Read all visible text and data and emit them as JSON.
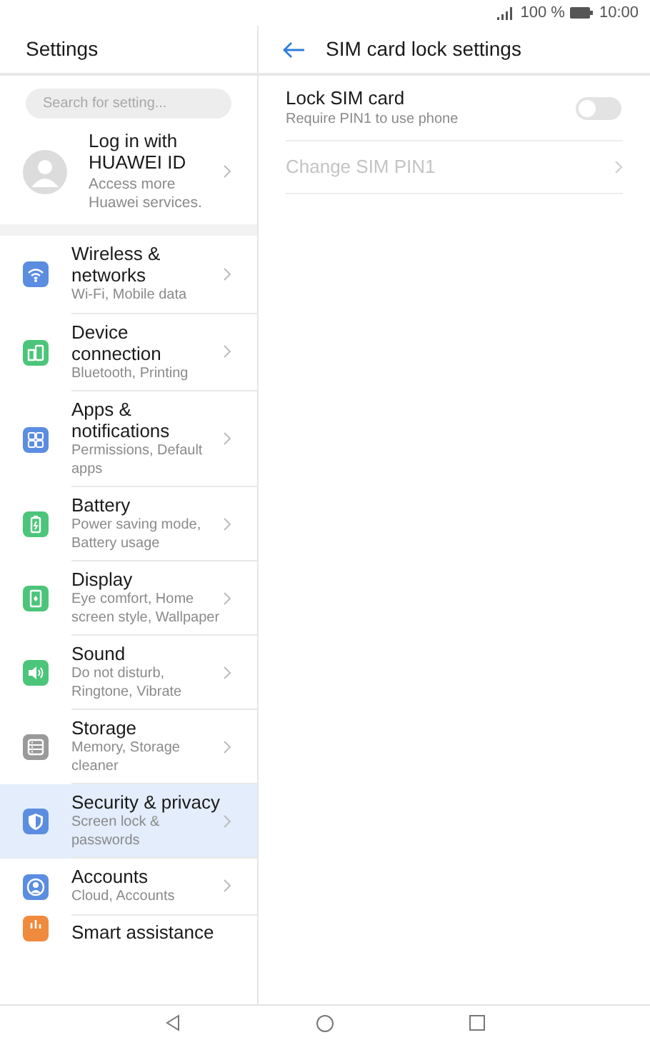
{
  "status_bar": {
    "battery_text": "100 %",
    "time": "10:00"
  },
  "sidebar": {
    "title": "Settings",
    "search": {
      "placeholder": "Search for setting..."
    },
    "account": {
      "title": "Log in with HUAWEI ID",
      "subtitle": "Access more Huawei services."
    },
    "items": [
      {
        "kind": "wifi",
        "color": "#5b8de0",
        "title": "Wireless & networks",
        "subtitle": "Wi-Fi, Mobile data",
        "selected": false
      },
      {
        "kind": "device",
        "color": "#4cc57a",
        "title": "Device connection",
        "subtitle": "Bluetooth, Printing",
        "selected": false
      },
      {
        "kind": "apps",
        "color": "#5b8de0",
        "title": "Apps & notifications",
        "subtitle": "Permissions, Default apps",
        "selected": false
      },
      {
        "kind": "battery",
        "color": "#4cc57a",
        "title": "Battery",
        "subtitle": "Power saving mode, Battery usage",
        "selected": false
      },
      {
        "kind": "display",
        "color": "#4cc57a",
        "title": "Display",
        "subtitle": "Eye comfort, Home screen style, Wallpaper",
        "selected": false
      },
      {
        "kind": "sound",
        "color": "#4cc57a",
        "title": "Sound",
        "subtitle": "Do not disturb, Ringtone, Vibrate",
        "selected": false
      },
      {
        "kind": "storage",
        "color": "#9a9a9a",
        "title": "Storage",
        "subtitle": "Memory, Storage cleaner",
        "selected": false
      },
      {
        "kind": "shield",
        "color": "#5b8de0",
        "title": "Security & privacy",
        "subtitle": "Screen lock & passwords",
        "selected": true
      },
      {
        "kind": "person",
        "color": "#5b8de0",
        "title": "Accounts",
        "subtitle": "Cloud, Accounts",
        "selected": false
      },
      {
        "kind": "smart",
        "color": "#f08a3c",
        "title": "Smart assistance",
        "selected": false
      }
    ]
  },
  "detail": {
    "title": "SIM card lock settings",
    "rows": [
      {
        "kind": "switch",
        "title": "Lock SIM card",
        "subtitle": "Require PIN1 to use phone",
        "on": false,
        "disabled": false
      },
      {
        "kind": "link",
        "title": "Change SIM PIN1",
        "disabled": true
      }
    ]
  }
}
